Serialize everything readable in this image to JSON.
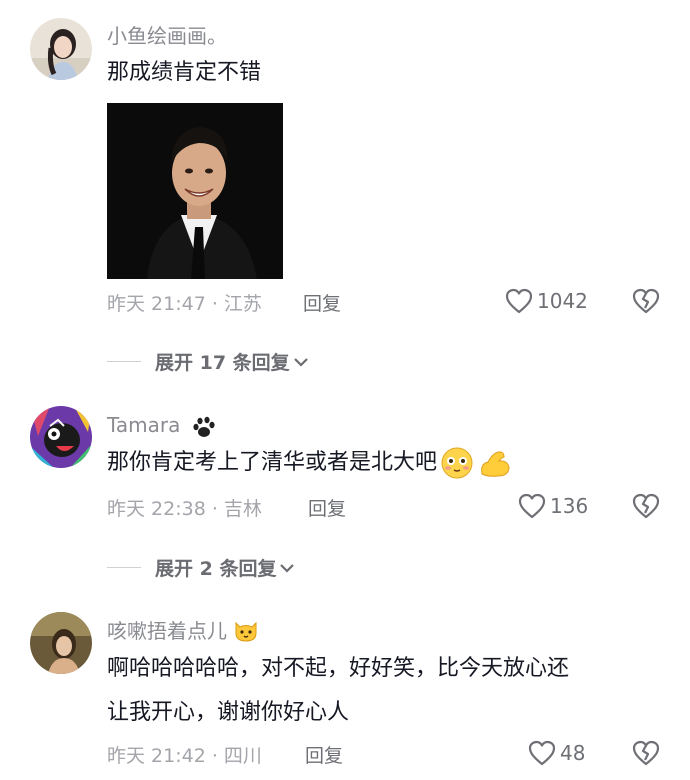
{
  "comments": [
    {
      "username": "小鱼绘画画。",
      "text": "那成绩肯定不错",
      "meta": "昨天 21:47 · 江苏",
      "reply_label": "回复",
      "likes": "1042",
      "expand_label": "展开 17 条回复"
    },
    {
      "username": "Tamara",
      "text": "那你肯定考上了清华或者是北大吧",
      "meta": "昨天 22:38 · 吉林",
      "reply_label": "回复",
      "likes": "136",
      "expand_label": "展开 2 条回复"
    },
    {
      "username": "咳嗽捂着点儿",
      "text_line1": "啊哈哈哈哈哈，对不起，好好笑，比今天放心还",
      "text_line2": "让我开心，谢谢你好心人",
      "meta": "昨天 21:42 · 四川",
      "reply_label": "回复",
      "likes": "48"
    }
  ],
  "icons": {
    "like": "heart-outline-icon",
    "dislike": "broken-heart-icon",
    "expand": "chevron-down-icon",
    "paw": "paw-print-icon",
    "cat": "cat-face-icon"
  }
}
